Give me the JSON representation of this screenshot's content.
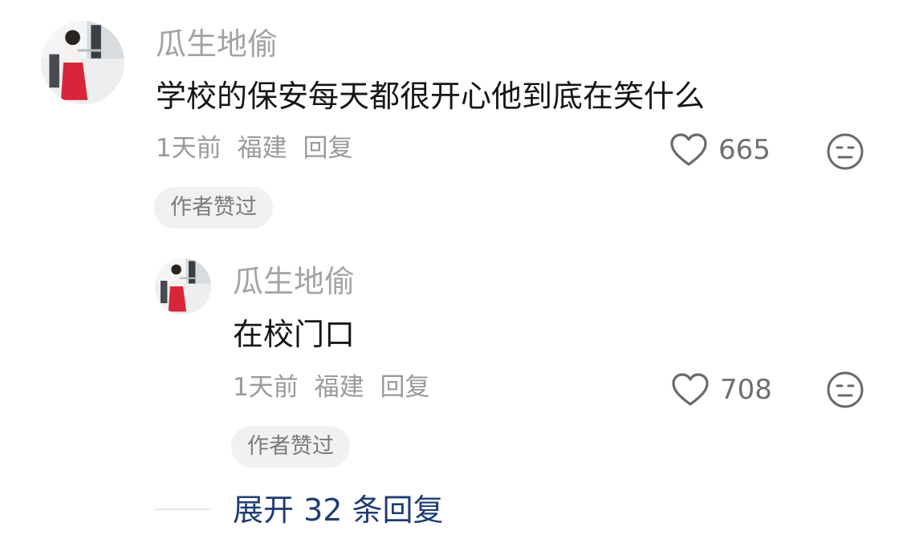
{
  "comment": {
    "username": "瓜生地偷",
    "text": "学校的保安每天都很开心他到底在笑什么",
    "time": "1天前",
    "location": "福建",
    "reply_label": "回复",
    "like_count": "665",
    "badge": "作者赞过",
    "icons": {
      "like": "heart-icon",
      "dislike": "meh-face-icon"
    }
  },
  "reply": {
    "username": "瓜生地偷",
    "text": "在校门口",
    "time": "1天前",
    "location": "福建",
    "reply_label": "回复",
    "like_count": "708",
    "badge": "作者赞过"
  },
  "expand_replies": {
    "label": "展开 32 条回复"
  },
  "colors": {
    "username": "#a3a3a3",
    "text": "#161616",
    "meta": "#9a9a9a",
    "expand_link": "#1f3d73",
    "badge_bg": "#f1f1f1"
  }
}
